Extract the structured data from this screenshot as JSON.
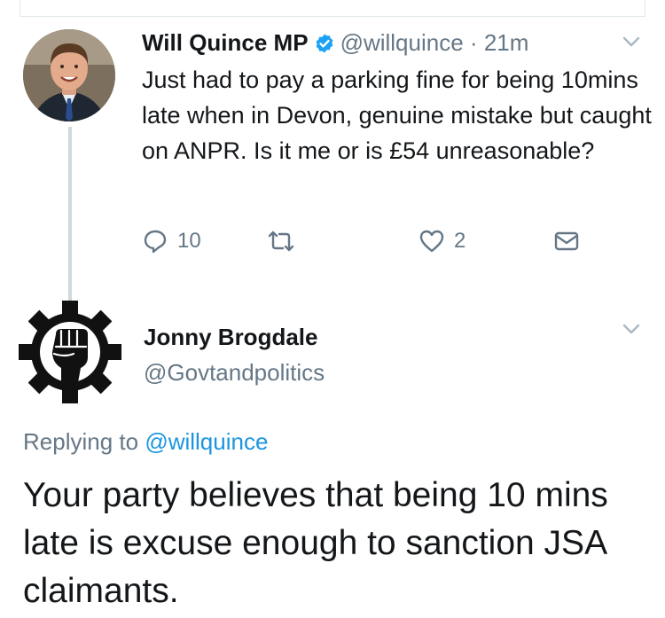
{
  "tweet1": {
    "author_name": "Will Quince MP",
    "handle": "@willquince",
    "separator": "·",
    "time": "21m",
    "text": "Just had to pay a parking fine for being 10mins late when in Devon, genuine mistake but caught on ANPR. Is it me or is £54 unreasonable?",
    "replies": "10",
    "likes": "2",
    "icons": [
      "verified-badge-icon",
      "chevron-down-icon",
      "reply-icon",
      "retweet-icon",
      "like-icon",
      "direct-message-icon"
    ]
  },
  "tweet2": {
    "author_name": "Jonny Brogdale",
    "handle": "@Govtandpolitics",
    "replying_prefix": "Replying to",
    "replying_handle": "@willquince",
    "text": "Your party believes that being 10 mins late is excuse enough to sanction JSA claimants.",
    "icons": [
      "raised-fist-gear-icon",
      "chevron-down-icon"
    ]
  },
  "colors": {
    "text": "#14171a",
    "secondary": "#657786",
    "link": "#1b95e0",
    "verified": "#1da1f2",
    "thread_line": "#cfd9de"
  }
}
